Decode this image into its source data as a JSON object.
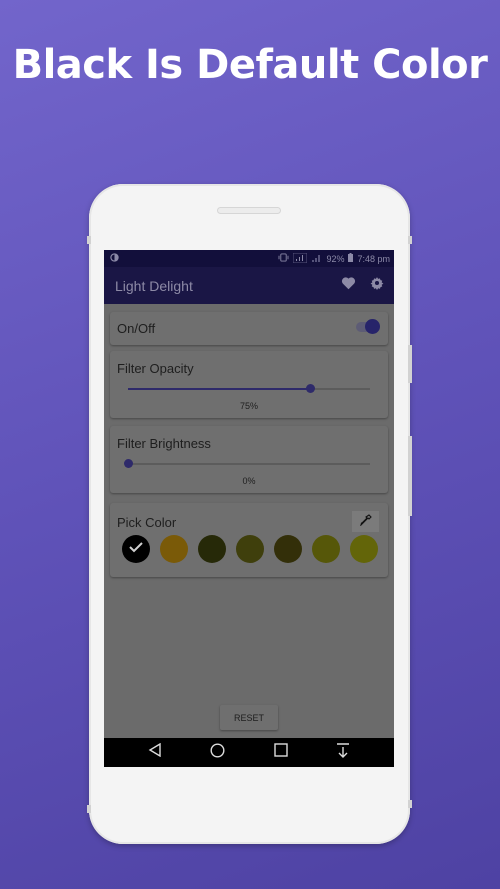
{
  "promo": {
    "headline": "Black Is Default Color"
  },
  "statusbar": {
    "battery": "92%",
    "time": "7:48 pm",
    "icons": [
      "night-mode-icon",
      "vibrate-icon",
      "signal-icon",
      "signal-weak-icon",
      "battery-icon"
    ]
  },
  "appbar": {
    "title": "Light Delight",
    "actions": [
      "heart-icon",
      "gear-icon"
    ]
  },
  "onoff": {
    "label": "On/Off",
    "enabled": true
  },
  "opacity": {
    "label": "Filter Opacity",
    "value_text": "75%",
    "value": 0.75
  },
  "brightness": {
    "label": "Filter Brightness",
    "value_text": "0%",
    "value": 0.0
  },
  "pick_color": {
    "label": "Pick Color",
    "eyedropper_icon": "eyedropper-icon",
    "selected_index": 0,
    "swatches": [
      "#000000",
      "#7a5a08",
      "#262908",
      "#3f3f0c",
      "#332f09",
      "#565709",
      "#636509"
    ]
  },
  "reset": {
    "label": "RESET"
  },
  "navbar": {
    "buttons": [
      "back-icon",
      "home-icon",
      "recents-icon",
      "notification-pull-icon"
    ]
  },
  "colors": {
    "background_top": "#7265cb",
    "background_bottom": "#4e42a3",
    "accent": "#27246a",
    "appbar": "#1a1645"
  }
}
